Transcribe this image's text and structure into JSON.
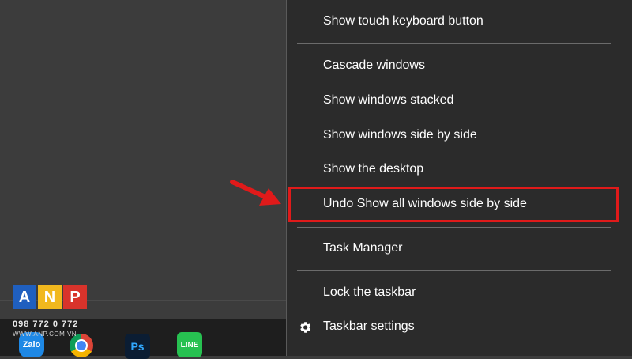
{
  "menu": {
    "items": [
      {
        "label": "Show touch keyboard button"
      },
      {
        "label": "Cascade windows"
      },
      {
        "label": "Show windows stacked"
      },
      {
        "label": "Show windows side by side"
      },
      {
        "label": "Show the desktop"
      },
      {
        "label": "Undo Show all windows side by side"
      },
      {
        "label": "Task Manager"
      },
      {
        "label": "Lock the taskbar"
      },
      {
        "label": "Taskbar settings",
        "icon": "gear-icon"
      }
    ]
  },
  "taskbar": {
    "icons": [
      {
        "name": "zalo-icon",
        "label": "Zalo"
      },
      {
        "name": "chrome-icon"
      },
      {
        "name": "photoshop-icon",
        "label": "Ps"
      },
      {
        "name": "line-icon",
        "label": "LINE"
      }
    ]
  },
  "watermark": {
    "letters": [
      "A",
      "N",
      "P"
    ],
    "phone": "098 772 0 772",
    "site": "WWW.ANP.COM.VN"
  },
  "colors": {
    "menu_bg": "#2b2b2b",
    "desktop_bg": "#3c3c3c",
    "highlight": "#e01a1a",
    "arrow": "#e01a1a"
  }
}
